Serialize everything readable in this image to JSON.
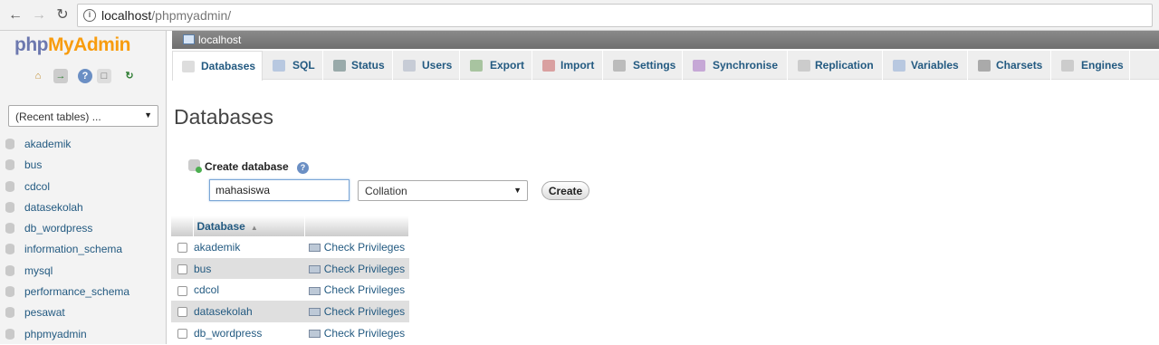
{
  "browser": {
    "url_host": "localhost",
    "url_path": "/phpmyadmin/"
  },
  "logo": {
    "php": "php",
    "myadmin": "MyAdmin"
  },
  "leftnav": {
    "recent_tables": "(Recent tables) ...",
    "databases": [
      "akademik",
      "bus",
      "cdcol",
      "datasekolah",
      "db_wordpress",
      "information_schema",
      "mysql",
      "performance_schema",
      "pesawat",
      "phpmyadmin"
    ]
  },
  "serverbar": {
    "label": "localhost"
  },
  "tabs": [
    {
      "label": "Databases",
      "icon": "database-icon",
      "active": true
    },
    {
      "label": "SQL",
      "icon": "sql-icon"
    },
    {
      "label": "Status",
      "icon": "status-icon"
    },
    {
      "label": "Users",
      "icon": "users-icon"
    },
    {
      "label": "Export",
      "icon": "export-icon"
    },
    {
      "label": "Import",
      "icon": "import-icon"
    },
    {
      "label": "Settings",
      "icon": "wrench-icon"
    },
    {
      "label": "Synchronise",
      "icon": "synchronise-icon"
    },
    {
      "label": "Replication",
      "icon": "replication-icon"
    },
    {
      "label": "Variables",
      "icon": "variables-icon"
    },
    {
      "label": "Charsets",
      "icon": "charsets-icon"
    },
    {
      "label": "Engines",
      "icon": "engines-icon"
    }
  ],
  "main": {
    "title": "Databases",
    "create_label": "Create database",
    "db_name_value": "mahasiswa",
    "collation": "Collation",
    "create_button": "Create"
  },
  "table": {
    "header_database": "Database",
    "rows": [
      {
        "name": "akademik",
        "action": "Check Privileges"
      },
      {
        "name": "bus",
        "action": "Check Privileges"
      },
      {
        "name": "cdcol",
        "action": "Check Privileges"
      },
      {
        "name": "datasekolah",
        "action": "Check Privileges"
      },
      {
        "name": "db_wordpress",
        "action": "Check Privileges"
      }
    ]
  }
}
